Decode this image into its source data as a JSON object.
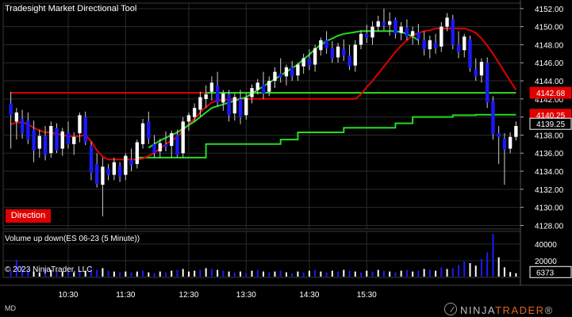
{
  "window": {
    "title": "Tradesight Market Directional Tool",
    "volume_title": "Volume up down(ES 06-23 (5 Minute))",
    "copyright": "© 2023 NinjaTrader, LLC",
    "direction_label": "Direction",
    "corner_label": "MD",
    "logo_prefix": "NINJA",
    "logo_suffix": "TRADER",
    "logo_registered": "®"
  },
  "colors": {
    "background": "#000000",
    "grid": "#2b2b2b",
    "up_candle": "#ffffff",
    "down_candle": "#1a1aff",
    "red_line": "#e00000",
    "green_line": "#22dd22",
    "price_tag_red": "#e00000",
    "volume_up": "#ffffff",
    "volume_down": "#1a1aff"
  },
  "chart_data": {
    "type": "candlestick",
    "price_axis": {
      "ylim": [
        4127.6,
        4152.6
      ],
      "ticks": [
        "4128.00",
        "4130.00",
        "4132.00",
        "4134.00",
        "4136.00",
        "4138.00",
        "4140.00",
        "4142.00",
        "4144.00",
        "4146.00",
        "4148.00",
        "4150.00",
        "4152.00"
      ],
      "tags": [
        {
          "label": "4142.68",
          "value": 4142.68,
          "color": "#e00000"
        },
        {
          "label": "4140.25",
          "value": 4140.25,
          "color": "#e00000"
        },
        {
          "label": "4139.25",
          "value": 4139.25,
          "color": "#ffffff"
        }
      ]
    },
    "volume_axis": {
      "ylim": [
        0,
        55000
      ],
      "ticks": [
        "20000",
        "40000"
      ],
      "tag": "6373"
    },
    "time_axis": {
      "labels": [
        "10:30",
        "11:30",
        "12:30",
        "13:30",
        "14:30",
        "15:30"
      ],
      "label_bar_index": [
        10,
        20,
        31,
        41,
        52,
        62
      ]
    },
    "candles": [
      {
        "o": 4141.5,
        "h": 4142.8,
        "l": 4136.5,
        "c": 4140.2
      },
      {
        "o": 4139.5,
        "h": 4141.0,
        "l": 4137.5,
        "c": 4140.5
      },
      {
        "o": 4139.8,
        "h": 4140.8,
        "l": 4137.6,
        "c": 4138.2
      },
      {
        "o": 4139.6,
        "h": 4140.5,
        "l": 4137.0,
        "c": 4137.5
      },
      {
        "o": 4138.6,
        "h": 4139.6,
        "l": 4135.0,
        "c": 4136.3
      },
      {
        "o": 4136.5,
        "h": 4138.6,
        "l": 4135.5,
        "c": 4137.9
      },
      {
        "o": 4137.9,
        "h": 4139.0,
        "l": 4135.2,
        "c": 4135.8
      },
      {
        "o": 4136.0,
        "h": 4139.5,
        "l": 4135.5,
        "c": 4139.0
      },
      {
        "o": 4138.8,
        "h": 4139.3,
        "l": 4136.0,
        "c": 4136.3
      },
      {
        "o": 4136.5,
        "h": 4138.8,
        "l": 4135.7,
        "c": 4138.4
      },
      {
        "o": 4138.3,
        "h": 4139.5,
        "l": 4136.5,
        "c": 4137.0
      },
      {
        "o": 4137.0,
        "h": 4138.3,
        "l": 4135.8,
        "c": 4137.8
      },
      {
        "o": 4138.2,
        "h": 4140.5,
        "l": 4137.2,
        "c": 4140.2
      },
      {
        "o": 4140.0,
        "h": 4140.6,
        "l": 4136.9,
        "c": 4137.2
      },
      {
        "o": 4136.8,
        "h": 4137.3,
        "l": 4133.0,
        "c": 4133.8
      },
      {
        "o": 4134.8,
        "h": 4136.0,
        "l": 4132.2,
        "c": 4132.6
      },
      {
        "o": 4132.5,
        "h": 4135.5,
        "l": 4129.0,
        "c": 4134.5
      },
      {
        "o": 4134.3,
        "h": 4134.8,
        "l": 4133.0,
        "c": 4133.6
      },
      {
        "o": 4133.6,
        "h": 4135.5,
        "l": 4133.0,
        "c": 4135.0
      },
      {
        "o": 4134.6,
        "h": 4135.0,
        "l": 4132.8,
        "c": 4133.4
      },
      {
        "o": 4133.6,
        "h": 4136.0,
        "l": 4133.0,
        "c": 4135.7
      },
      {
        "o": 4135.3,
        "h": 4136.5,
        "l": 4134.0,
        "c": 4134.7
      },
      {
        "o": 4134.8,
        "h": 4137.5,
        "l": 4134.3,
        "c": 4137.2
      },
      {
        "o": 4137.0,
        "h": 4139.8,
        "l": 4136.5,
        "c": 4139.3
      },
      {
        "o": 4139.5,
        "h": 4140.6,
        "l": 4137.0,
        "c": 4137.6
      },
      {
        "o": 4137.0,
        "h": 4138.0,
        "l": 4135.5,
        "c": 4136.0
      },
      {
        "o": 4136.2,
        "h": 4137.6,
        "l": 4135.5,
        "c": 4137.1
      },
      {
        "o": 4137.0,
        "h": 4138.4,
        "l": 4136.2,
        "c": 4136.7
      },
      {
        "o": 4136.8,
        "h": 4138.5,
        "l": 4135.5,
        "c": 4138.2
      },
      {
        "o": 4138.0,
        "h": 4138.6,
        "l": 4135.5,
        "c": 4135.8
      },
      {
        "o": 4136.0,
        "h": 4140.0,
        "l": 4135.5,
        "c": 4139.5
      },
      {
        "o": 4139.5,
        "h": 4140.5,
        "l": 4138.5,
        "c": 4140.2
      },
      {
        "o": 4140.0,
        "h": 4141.5,
        "l": 4139.5,
        "c": 4141.0
      },
      {
        "o": 4140.8,
        "h": 4142.8,
        "l": 4140.0,
        "c": 4142.2
      },
      {
        "o": 4142.0,
        "h": 4143.5,
        "l": 4141.0,
        "c": 4142.5
      },
      {
        "o": 4142.8,
        "h": 4144.5,
        "l": 4141.8,
        "c": 4143.8
      },
      {
        "o": 4143.5,
        "h": 4145.0,
        "l": 4141.2,
        "c": 4141.6
      },
      {
        "o": 4141.6,
        "h": 4143.0,
        "l": 4140.7,
        "c": 4142.6
      },
      {
        "o": 4142.5,
        "h": 4143.0,
        "l": 4139.5,
        "c": 4140.2
      },
      {
        "o": 4140.4,
        "h": 4142.6,
        "l": 4139.6,
        "c": 4142.2
      },
      {
        "o": 4142.0,
        "h": 4143.0,
        "l": 4139.2,
        "c": 4140.0
      },
      {
        "o": 4140.2,
        "h": 4142.6,
        "l": 4139.7,
        "c": 4142.1
      },
      {
        "o": 4142.2,
        "h": 4143.6,
        "l": 4141.5,
        "c": 4143.2
      },
      {
        "o": 4143.0,
        "h": 4144.2,
        "l": 4142.5,
        "c": 4143.8
      },
      {
        "o": 4143.6,
        "h": 4145.0,
        "l": 4142.0,
        "c": 4142.6
      },
      {
        "o": 4142.8,
        "h": 4144.5,
        "l": 4142.3,
        "c": 4144.0
      },
      {
        "o": 4144.0,
        "h": 4145.5,
        "l": 4143.2,
        "c": 4145.0
      },
      {
        "o": 4144.8,
        "h": 4146.5,
        "l": 4143.8,
        "c": 4144.4
      },
      {
        "o": 4144.5,
        "h": 4145.8,
        "l": 4143.5,
        "c": 4145.5
      },
      {
        "o": 4145.5,
        "h": 4146.2,
        "l": 4144.0,
        "c": 4144.5
      },
      {
        "o": 4144.6,
        "h": 4146.0,
        "l": 4144.0,
        "c": 4145.8
      },
      {
        "o": 4145.6,
        "h": 4147.0,
        "l": 4144.8,
        "c": 4146.5
      },
      {
        "o": 4146.5,
        "h": 4147.5,
        "l": 4145.2,
        "c": 4145.7
      },
      {
        "o": 4145.8,
        "h": 4148.0,
        "l": 4145.0,
        "c": 4147.6
      },
      {
        "o": 4147.4,
        "h": 4148.8,
        "l": 4146.8,
        "c": 4148.5
      },
      {
        "o": 4148.5,
        "h": 4149.5,
        "l": 4147.0,
        "c": 4147.6
      },
      {
        "o": 4147.6,
        "h": 4148.4,
        "l": 4146.0,
        "c": 4146.5
      },
      {
        "o": 4146.6,
        "h": 4148.2,
        "l": 4146.0,
        "c": 4147.8
      },
      {
        "o": 4147.5,
        "h": 4148.6,
        "l": 4146.2,
        "c": 4146.8
      },
      {
        "o": 4146.8,
        "h": 4148.0,
        "l": 4145.2,
        "c": 4145.6
      },
      {
        "o": 4145.7,
        "h": 4148.5,
        "l": 4145.0,
        "c": 4148.0
      },
      {
        "o": 4148.0,
        "h": 4149.6,
        "l": 4147.5,
        "c": 4149.2
      },
      {
        "o": 4149.2,
        "h": 4150.2,
        "l": 4148.2,
        "c": 4148.8
      },
      {
        "o": 4148.8,
        "h": 4150.6,
        "l": 4148.0,
        "c": 4150.0
      },
      {
        "o": 4150.0,
        "h": 4151.2,
        "l": 4149.5,
        "c": 4150.6
      },
      {
        "o": 4150.5,
        "h": 4152.0,
        "l": 4149.6,
        "c": 4150.1
      },
      {
        "o": 4150.2,
        "h": 4151.6,
        "l": 4149.0,
        "c": 4150.6
      },
      {
        "o": 4150.8,
        "h": 4151.0,
        "l": 4148.7,
        "c": 4149.2
      },
      {
        "o": 4149.3,
        "h": 4150.5,
        "l": 4148.5,
        "c": 4150.0
      },
      {
        "o": 4149.9,
        "h": 4150.8,
        "l": 4148.5,
        "c": 4148.9
      },
      {
        "o": 4149.0,
        "h": 4150.0,
        "l": 4148.0,
        "c": 4149.5
      },
      {
        "o": 4149.4,
        "h": 4150.3,
        "l": 4148.0,
        "c": 4148.6
      },
      {
        "o": 4148.5,
        "h": 4149.5,
        "l": 4146.8,
        "c": 4147.5
      },
      {
        "o": 4147.5,
        "h": 4149.0,
        "l": 4146.5,
        "c": 4148.5
      },
      {
        "o": 4148.2,
        "h": 4149.2,
        "l": 4147.0,
        "c": 4147.6
      },
      {
        "o": 4147.8,
        "h": 4150.5,
        "l": 4147.2,
        "c": 4150.0
      },
      {
        "o": 4150.0,
        "h": 4151.5,
        "l": 4149.5,
        "c": 4151.0
      },
      {
        "o": 4150.8,
        "h": 4151.3,
        "l": 4147.5,
        "c": 4148.0
      },
      {
        "o": 4148.0,
        "h": 4149.5,
        "l": 4146.5,
        "c": 4147.2
      },
      {
        "o": 4147.4,
        "h": 4149.2,
        "l": 4146.6,
        "c": 4148.9
      },
      {
        "o": 4148.6,
        "h": 4149.0,
        "l": 4145.0,
        "c": 4145.4
      },
      {
        "o": 4145.3,
        "h": 4146.5,
        "l": 4144.0,
        "c": 4144.5
      },
      {
        "o": 4144.6,
        "h": 4146.5,
        "l": 4143.8,
        "c": 4146.1
      },
      {
        "o": 4146.0,
        "h": 4146.6,
        "l": 4141.0,
        "c": 4141.6
      },
      {
        "o": 4141.8,
        "h": 4142.3,
        "l": 4137.5,
        "c": 4138.1
      },
      {
        "o": 4138.2,
        "h": 4139.0,
        "l": 4134.8,
        "c": 4137.8
      },
      {
        "o": 4137.6,
        "h": 4138.2,
        "l": 4132.5,
        "c": 4136.4
      },
      {
        "o": 4136.5,
        "h": 4138.3,
        "l": 4136.0,
        "c": 4137.8
      },
      {
        "o": 4137.8,
        "h": 4139.5,
        "l": 4137.4,
        "c": 4139.0
      }
    ],
    "red_line": [
      4139.2,
      4139.4,
      4139.4,
      4139.2,
      4138.8,
      4138.5,
      4138.3,
      4138.3,
      4138.1,
      4138.0,
      4137.9,
      4137.8,
      4137.9,
      4138.0,
      4137.3,
      4136.3,
      4135.6,
      4135.3,
      4135.3,
      4135.3,
      4135.3,
      4135.3,
      4135.3,
      4135.4,
      4135.7,
      4136.0,
      4136.5,
      4137.0,
      4137.4,
      4137.8,
      4138.5,
      4139.2,
      4139.8,
      4140.5,
      4141.1,
      4141.6,
      4141.8,
      4141.9,
      4141.9,
      4142.0,
      4142.0,
      4142.0,
      4142.0,
      4142.0,
      4142.0,
      4142.0,
      4142.0,
      4142.0,
      4142.0,
      4142.0,
      4142.0,
      4142.0,
      4142.0,
      4142.0,
      4142.0,
      4142.0,
      4142.0,
      4142.0,
      4142.0,
      4142.0,
      4142.0,
      4142.5,
      4143.3,
      4144.0,
      4144.8,
      4145.6,
      4146.4,
      4147.2,
      4147.9,
      4148.5,
      4149.0,
      4149.3,
      4149.5,
      4149.6,
      4149.8,
      4149.8,
      4149.8,
      4149.8,
      4149.8,
      4149.8,
      4149.6,
      4149.3,
      4148.7,
      4147.9,
      4147.0,
      4146.0,
      4145.0,
      4144.0,
      4143.0
    ],
    "green_line": [
      null,
      null,
      null,
      null,
      null,
      null,
      null,
      null,
      null,
      null,
      null,
      null,
      null,
      null,
      null,
      null,
      null,
      null,
      null,
      null,
      null,
      null,
      null,
      null,
      4136.6,
      4137.0,
      4137.4,
      4137.7,
      4138.0,
      4138.3,
      4138.7,
      4139.1,
      4139.5,
      4140.0,
      4140.5,
      4141.0,
      4141.2,
      4141.4,
      4141.6,
      4141.8,
      4142.0,
      4142.2,
      4142.6,
      4143.0,
      4143.4,
      4143.8,
      4144.2,
      4144.6,
      4145.0,
      4145.4,
      4145.8,
      4146.4,
      4146.9,
      4147.5,
      4148.0,
      4148.4,
      4148.7,
      4149.0,
      4149.2,
      4149.3,
      4149.4,
      4149.5,
      4149.5,
      4149.5,
      4149.5,
      4149.5,
      4149.5,
      4149.5,
      4149.4,
      4149.2,
      4148.9,
      4148.5
    ],
    "flat_lines": [
      {
        "name": "red_horizontal",
        "value": 4142.68,
        "from_bar": 0,
        "to_bar": 88,
        "color": "#e00000"
      },
      {
        "name": "green_horizontal",
        "value": 4142.68,
        "from_bar": 34,
        "to_bar": 88,
        "color": "#22dd22"
      }
    ],
    "green_step_line": [
      {
        "from_bar": 22,
        "to_bar": 34,
        "value": 4135.5
      },
      {
        "from_bar": 34,
        "to_bar": 47,
        "value": 4137.0
      },
      {
        "from_bar": 47,
        "to_bar": 50,
        "value": 4137.5
      },
      {
        "from_bar": 50,
        "to_bar": 58,
        "value": 4138.3
      },
      {
        "from_bar": 58,
        "to_bar": 67,
        "value": 4138.8
      },
      {
        "from_bar": 67,
        "to_bar": 70,
        "value": 4139.3
      },
      {
        "from_bar": 70,
        "to_bar": 77,
        "value": 4140.0
      },
      {
        "from_bar": 77,
        "to_bar": 81,
        "value": 4140.2
      },
      {
        "from_bar": 81,
        "to_bar": 88,
        "value": 4140.25
      }
    ],
    "volume": [
      {
        "v": 9000,
        "up": false
      },
      {
        "v": 21000,
        "up": false
      },
      {
        "v": 14000,
        "up": false
      },
      {
        "v": 9000,
        "up": false
      },
      {
        "v": 7000,
        "up": true
      },
      {
        "v": 6000,
        "up": true
      },
      {
        "v": 11000,
        "up": false
      },
      {
        "v": 9000,
        "up": true
      },
      {
        "v": 8000,
        "up": false
      },
      {
        "v": 7000,
        "up": true
      },
      {
        "v": 8000,
        "up": false
      },
      {
        "v": 6000,
        "up": true
      },
      {
        "v": 9000,
        "up": false
      },
      {
        "v": 8000,
        "up": true
      },
      {
        "v": 10000,
        "up": false
      },
      {
        "v": 9000,
        "up": false
      },
      {
        "v": 11000,
        "up": true
      },
      {
        "v": 8000,
        "up": false
      },
      {
        "v": 7000,
        "up": true
      },
      {
        "v": 6000,
        "up": false
      },
      {
        "v": 7000,
        "up": true
      },
      {
        "v": 6000,
        "up": false
      },
      {
        "v": 7000,
        "up": true
      },
      {
        "v": 8000,
        "up": false
      },
      {
        "v": 6000,
        "up": true
      },
      {
        "v": 5000,
        "up": false
      },
      {
        "v": 7000,
        "up": true
      },
      {
        "v": 6000,
        "up": false
      },
      {
        "v": 8000,
        "up": true
      },
      {
        "v": 9000,
        "up": false
      },
      {
        "v": 10000,
        "up": true
      },
      {
        "v": 7000,
        "up": true
      },
      {
        "v": 8000,
        "up": true
      },
      {
        "v": 9000,
        "up": false
      },
      {
        "v": 11000,
        "up": true
      },
      {
        "v": 10000,
        "up": false
      },
      {
        "v": 9000,
        "up": true
      },
      {
        "v": 8000,
        "up": false
      },
      {
        "v": 7000,
        "up": true
      },
      {
        "v": 6000,
        "up": false
      },
      {
        "v": 7000,
        "up": true
      },
      {
        "v": 5000,
        "up": false
      },
      {
        "v": 8000,
        "up": true
      },
      {
        "v": 9000,
        "up": false
      },
      {
        "v": 7000,
        "up": true
      },
      {
        "v": 6000,
        "up": false
      },
      {
        "v": 7000,
        "up": true
      },
      {
        "v": 8000,
        "up": false
      },
      {
        "v": 6000,
        "up": true
      },
      {
        "v": 5000,
        "up": false
      },
      {
        "v": 7000,
        "up": true
      },
      {
        "v": 6000,
        "up": false
      },
      {
        "v": 8000,
        "up": true
      },
      {
        "v": 9000,
        "up": false
      },
      {
        "v": 7000,
        "up": true
      },
      {
        "v": 6000,
        "up": false
      },
      {
        "v": 8000,
        "up": true
      },
      {
        "v": 7000,
        "up": false
      },
      {
        "v": 9000,
        "up": true
      },
      {
        "v": 8000,
        "up": false
      },
      {
        "v": 7000,
        "up": true
      },
      {
        "v": 6000,
        "up": false
      },
      {
        "v": 8000,
        "up": true
      },
      {
        "v": 7000,
        "up": false
      },
      {
        "v": 9000,
        "up": true
      },
      {
        "v": 8000,
        "up": false
      },
      {
        "v": 7000,
        "up": true
      },
      {
        "v": 6000,
        "up": false
      },
      {
        "v": 8000,
        "up": true
      },
      {
        "v": 9000,
        "up": false
      },
      {
        "v": 7000,
        "up": true
      },
      {
        "v": 8000,
        "up": false
      },
      {
        "v": 10000,
        "up": true
      },
      {
        "v": 9000,
        "up": false
      },
      {
        "v": 8000,
        "up": true
      },
      {
        "v": 12000,
        "up": false
      },
      {
        "v": 10000,
        "up": true
      },
      {
        "v": 11000,
        "up": false
      },
      {
        "v": 15000,
        "up": false
      },
      {
        "v": 19000,
        "up": false
      },
      {
        "v": 17000,
        "up": true
      },
      {
        "v": 14000,
        "up": true
      },
      {
        "v": 22000,
        "up": false
      },
      {
        "v": 30000,
        "up": false
      },
      {
        "v": 52000,
        "up": false
      },
      {
        "v": 24000,
        "up": true
      },
      {
        "v": 12000,
        "up": true
      },
      {
        "v": 6373,
        "up": true
      },
      {
        "v": 5000,
        "up": true
      }
    ]
  }
}
